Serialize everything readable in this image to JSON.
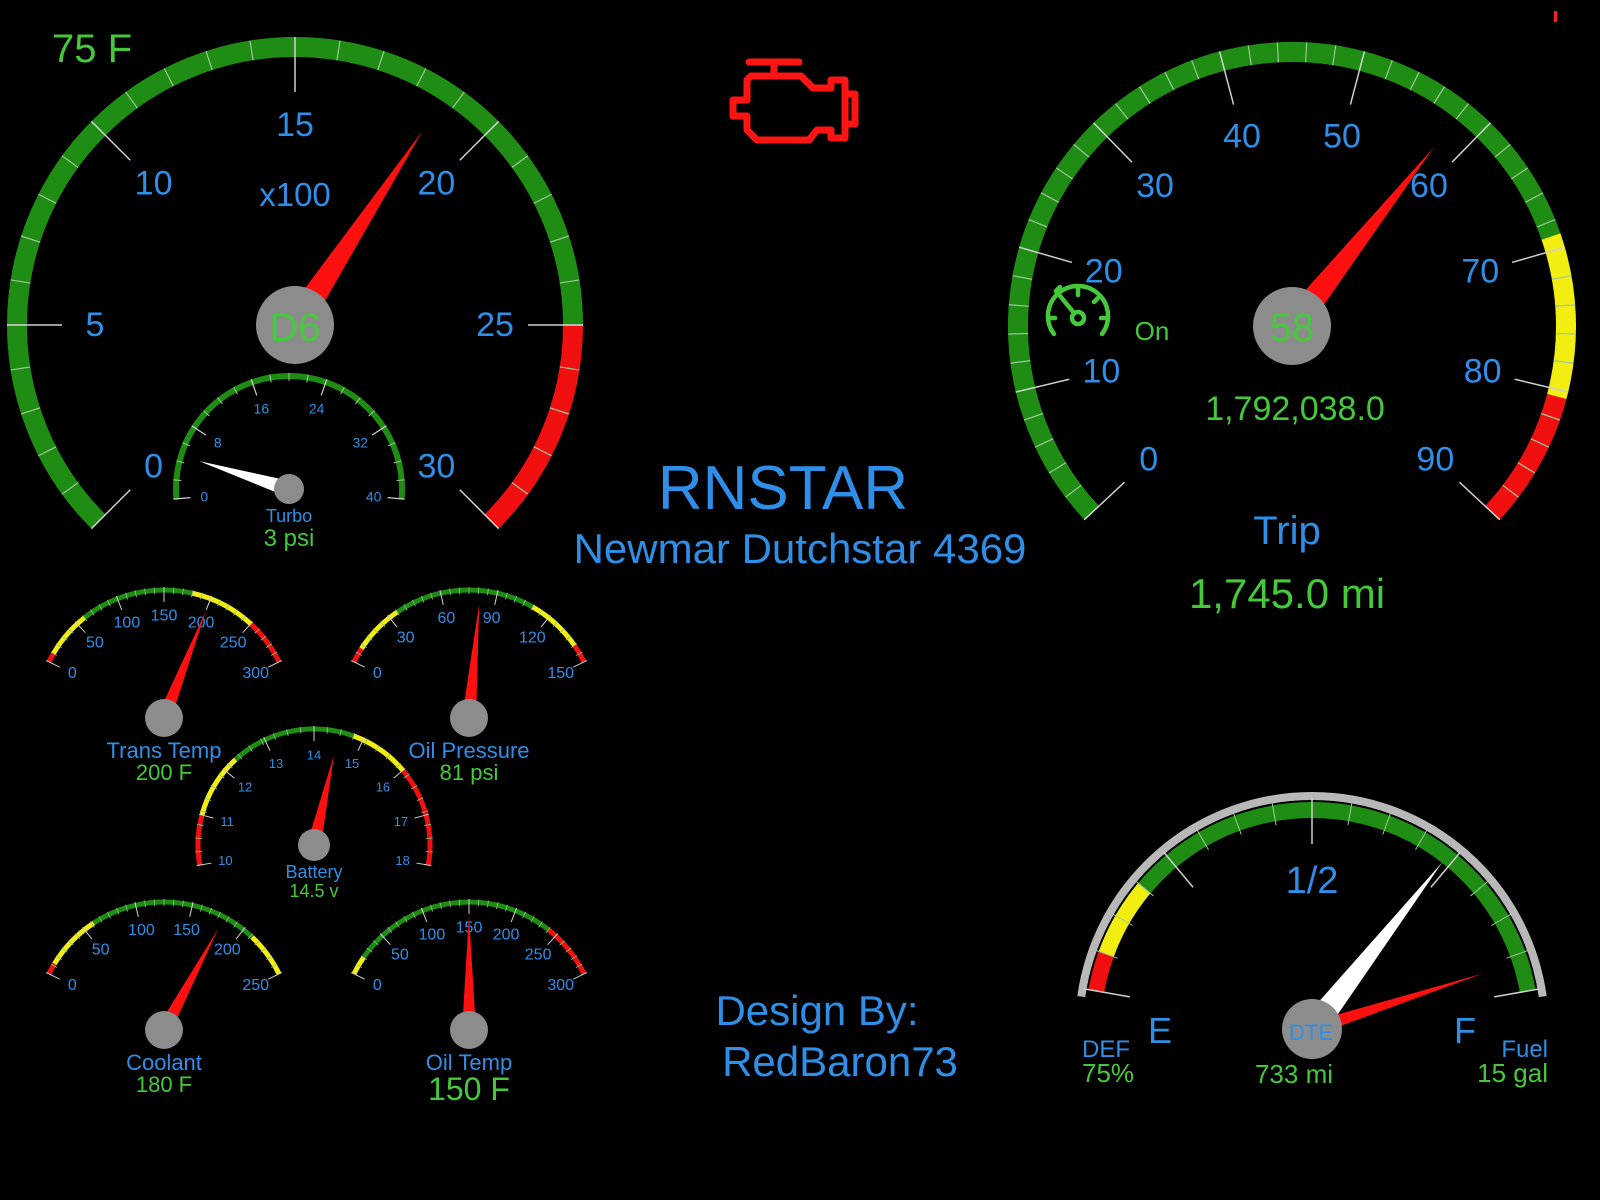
{
  "colors": {
    "background": "#000000",
    "label_blue": "#2f8fe8",
    "value_green": "#45c93a",
    "zone_green": "#1f8c14",
    "zone_yellow": "#f2ee12",
    "zone_red": "#f01010",
    "needle_red": "#ff1010",
    "needle_white": "#ffffff",
    "hub_gray": "#8c8c8c",
    "check_engine_red": "#ff1414"
  },
  "header": {
    "title": "RNSTAR",
    "subtitle": "Newmar Dutchstar 4369",
    "credit_line1": "Design By:",
    "credit_line2": "RedBaron73",
    "outside_temp": "75 F",
    "check_engine_icon": "check-engine-icon"
  },
  "tach": {
    "unit": "x100",
    "gear": "D6",
    "ticks": [
      "0",
      "5",
      "10",
      "15",
      "20",
      "25",
      "30"
    ],
    "min": 0,
    "max": 30,
    "value": 18.7
  },
  "turbo": {
    "label": "Turbo",
    "value": "3 psi",
    "ticks": [
      "0",
      "8",
      "16",
      "24",
      "32",
      "40"
    ],
    "min": 0,
    "max": 40,
    "reading": 3
  },
  "speedo": {
    "ticks": [
      "0",
      "10",
      "20",
      "30",
      "40",
      "50",
      "60",
      "70",
      "80",
      "90"
    ],
    "min": 0,
    "max": 90,
    "value": 58,
    "speed": "58",
    "odometer": "1,792,038.0",
    "cruise_icon": "cruise-control-icon",
    "cruise_status": "On",
    "trip_label": "Trip",
    "trip_value": "1,745.0 mi"
  },
  "small_gauges": [
    {
      "id": "trans",
      "label": "Trans Temp",
      "value": "200 F",
      "ticks": [
        "0",
        "50",
        "100",
        "150",
        "200",
        "250",
        "300"
      ],
      "min": 0,
      "max": 300,
      "reading": 200
    },
    {
      "id": "oilp",
      "label": "Oil Pressure",
      "value": "81 psi",
      "ticks": [
        "0",
        "30",
        "60",
        "90",
        "120",
        "150"
      ],
      "min": 0,
      "max": 150,
      "reading": 81
    },
    {
      "id": "battery",
      "label": "Battery",
      "value": "14.5 v",
      "ticks": [
        "10",
        "11",
        "12",
        "13",
        "14",
        "15",
        "16",
        "17",
        "18"
      ],
      "min": 10,
      "max": 18,
      "reading": 14.5
    },
    {
      "id": "coolant",
      "label": "Coolant",
      "value": "180 F",
      "ticks": [
        "0",
        "50",
        "100",
        "150",
        "200",
        "250"
      ],
      "min": 0,
      "max": 250,
      "reading": 180
    },
    {
      "id": "oilt",
      "label": "Oil Temp",
      "value": "150 F",
      "ticks": [
        "0",
        "50",
        "100",
        "150",
        "200",
        "250",
        "300"
      ],
      "min": 0,
      "max": 300,
      "reading": 150
    }
  ],
  "fuel": {
    "empty": "E",
    "full": "F",
    "half": "1/2",
    "hub_label": "DTE",
    "dte_value": "733 mi",
    "def_label": "DEF",
    "def_value": "75%",
    "def_level": 0.75,
    "fuel_label": "Fuel",
    "fuel_value": "15 gal",
    "fuel_level": 0.85
  }
}
